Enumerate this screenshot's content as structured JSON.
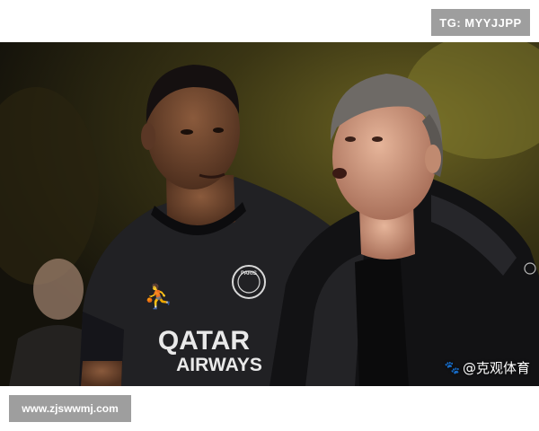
{
  "header": {
    "tag": "TG: MYYJJPP"
  },
  "footer": {
    "site": "www.zjswwmj.com"
  },
  "photo": {
    "watermark": "@克观体育",
    "watermark_icon": "paw-icon",
    "jersey": {
      "brand_line1": "QATAR",
      "brand_line2": "AIRWAYS",
      "crest_text": "PARIS"
    }
  }
}
